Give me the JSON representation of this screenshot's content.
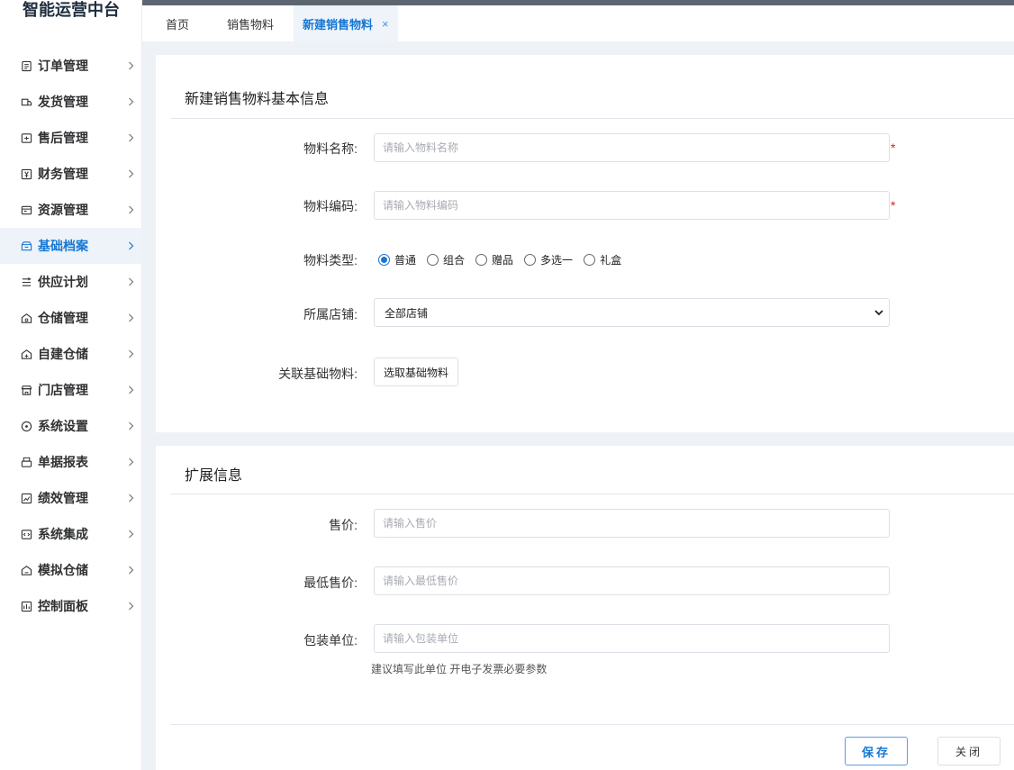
{
  "app": {
    "title": "智能运营中台"
  },
  "sidebar": {
    "items": [
      {
        "label": "订单管理",
        "icon": "order-icon",
        "active": false
      },
      {
        "label": "发货管理",
        "icon": "delivery-icon",
        "active": false
      },
      {
        "label": "售后管理",
        "icon": "aftersale-icon",
        "active": false
      },
      {
        "label": "财务管理",
        "icon": "finance-icon",
        "active": false
      },
      {
        "label": "资源管理",
        "icon": "resource-icon",
        "active": false
      },
      {
        "label": "基础档案",
        "icon": "archive-icon",
        "active": true
      },
      {
        "label": "供应计划",
        "icon": "supply-icon",
        "active": false
      },
      {
        "label": "仓储管理",
        "icon": "warehouse-icon",
        "active": false
      },
      {
        "label": "自建仓储",
        "icon": "self-warehouse-icon",
        "active": false
      },
      {
        "label": "门店管理",
        "icon": "store-icon",
        "active": false
      },
      {
        "label": "系统设置",
        "icon": "settings-icon",
        "active": false
      },
      {
        "label": "单据报表",
        "icon": "report-icon",
        "active": false
      },
      {
        "label": "绩效管理",
        "icon": "performance-icon",
        "active": false
      },
      {
        "label": "系统集成",
        "icon": "integration-icon",
        "active": false
      },
      {
        "label": "模拟仓储",
        "icon": "simulate-icon",
        "active": false
      },
      {
        "label": "控制面板",
        "icon": "dashboard-icon",
        "active": false
      }
    ]
  },
  "tabs": [
    {
      "label": "首页",
      "active": false
    },
    {
      "label": "销售物料",
      "active": false
    },
    {
      "label": "新建销售物料",
      "active": true,
      "close": "×"
    }
  ],
  "basic_section": {
    "title": "新建销售物料基本信息",
    "name_label": "物料名称:",
    "name_placeholder": "请输入物料名称",
    "code_label": "物料编码:",
    "code_placeholder": "请输入物料编码",
    "required_mark": "*",
    "type_label": "物料类型:",
    "type_options": [
      "普通",
      "组合",
      "赠品",
      "多选一",
      "礼盒"
    ],
    "type_selected": "普通",
    "store_label": "所属店铺:",
    "store_value": "全部店铺",
    "link_label": "关联基础物料:",
    "link_button": "选取基础物料"
  },
  "ext_section": {
    "title": "扩展信息",
    "price_label": "售价:",
    "price_placeholder": "请输入售价",
    "min_price_label": "最低售价:",
    "min_price_placeholder": "请输入最低售价",
    "unit_label": "包装单位:",
    "unit_placeholder": "请输入包装单位",
    "unit_hint": "建议填写此单位 开电子发票必要参数"
  },
  "footer": {
    "save": "保存",
    "close": "关闭"
  },
  "colors": {
    "accent": "#1677d2",
    "topbar": "#5b6670",
    "page_bg": "#eef2f7",
    "required": "#e02020"
  }
}
